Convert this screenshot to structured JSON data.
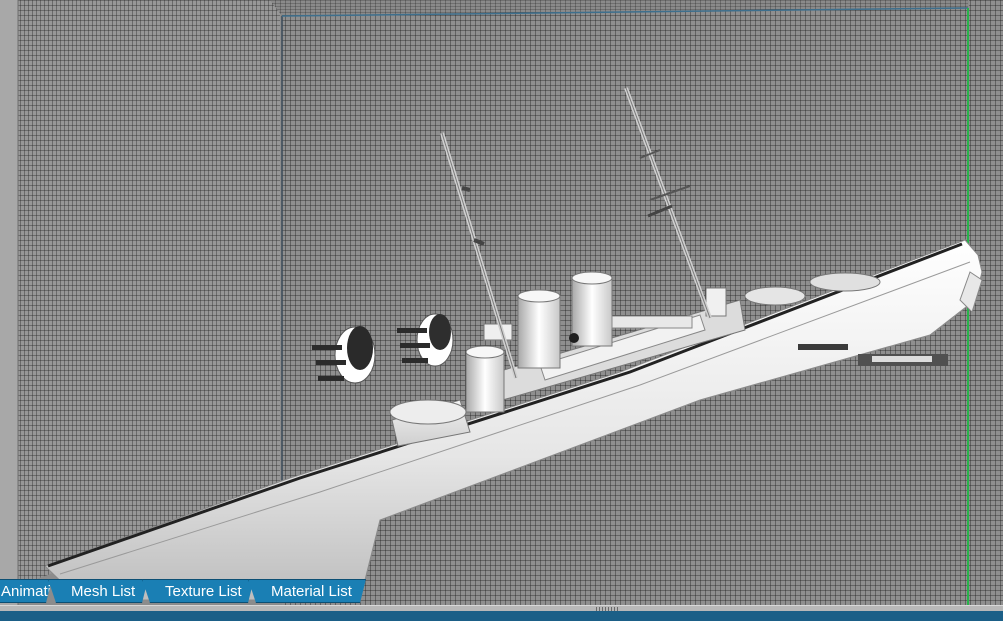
{
  "viewport": {
    "label": "3D viewport"
  },
  "tabs": [
    {
      "label": "Animation List"
    },
    {
      "label": "Mesh List"
    },
    {
      "label": "Texture List"
    },
    {
      "label": "Material List"
    }
  ],
  "colors": {
    "tab_bg": "#1a7fb4",
    "status_bg": "#1b5f87",
    "grid_line": "#1e1e1e",
    "grid_bg": "#8f8f8f"
  },
  "status": {
    "text": ""
  }
}
